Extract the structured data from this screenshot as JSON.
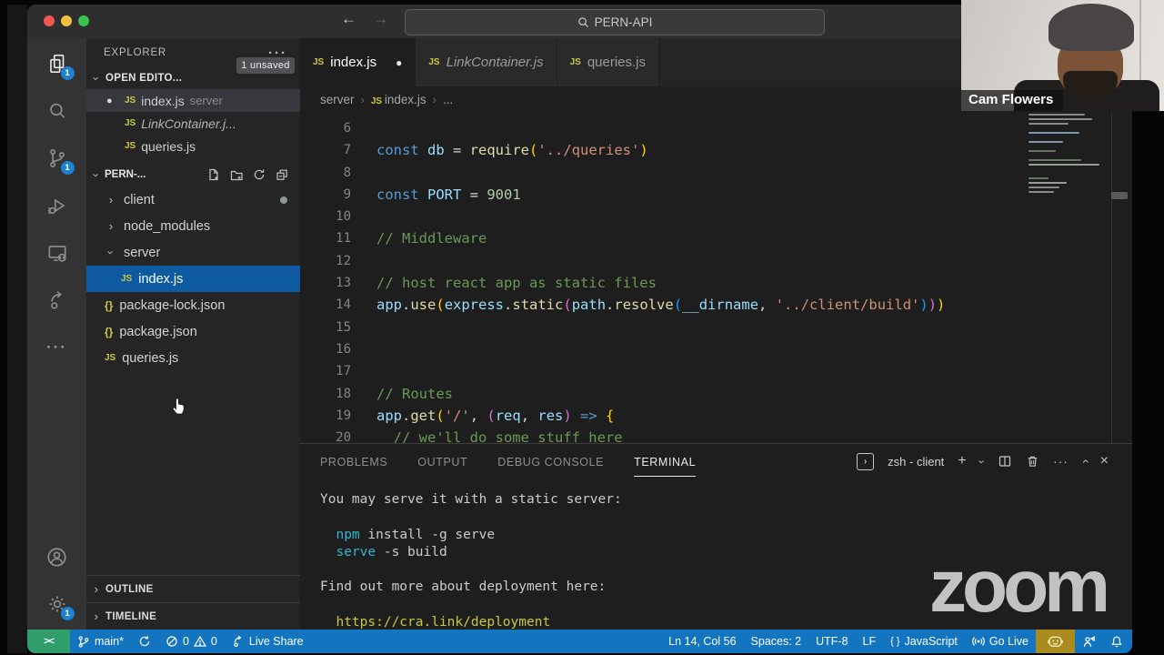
{
  "colors": {
    "status_bar_blue": "#1374c0",
    "remote_segment_green": "#2f9e6a",
    "gold_item": "#a98c1d",
    "selection_blue": "#0e5aa0",
    "activity_badge_blue": "#1d82d4",
    "js_icon_yellow": "#cbcb41"
  },
  "icons": {
    "more": "···",
    "plus": "+",
    "close": "×",
    "chevron": "›",
    "remote": "><",
    "js_badge": "JS",
    "json_badge": "{}",
    "dirty_dot": "●",
    "arrow_back": "←",
    "arrow_forward": "→",
    "brace_pair": "{ }",
    "zsh_glyph": "›"
  },
  "titlebar": {
    "search_title": "PERN-API"
  },
  "activity_bar": {
    "explorer_badge": "1",
    "scm_badge": "1",
    "settings_badge": "1"
  },
  "sidebar": {
    "title": "EXPLORER",
    "open_editors": {
      "label": "OPEN EDITO...",
      "badge": "1 unsaved",
      "items": [
        {
          "label": "index.js",
          "detail": "server",
          "modified": true,
          "selected": true
        },
        {
          "label": "LinkContainer.j...",
          "italic": true
        },
        {
          "label": "queries.js"
        }
      ]
    },
    "tree": {
      "root": "PERN-...",
      "items": [
        {
          "label": "client",
          "chevron": "right",
          "dot": true
        },
        {
          "label": "node_modules",
          "chevron": "right"
        },
        {
          "label": "server",
          "chevron": "down"
        },
        {
          "label": "index.js",
          "icon": "js",
          "indent": 2,
          "selected": true
        },
        {
          "label": "package-lock.json",
          "icon": "json"
        },
        {
          "label": "package.json",
          "icon": "json"
        },
        {
          "label": "queries.js",
          "icon": "js"
        }
      ]
    },
    "outline_label": "OUTLINE",
    "timeline_label": "TIMELINE"
  },
  "tabs": [
    {
      "label": "index.js",
      "active": true,
      "dirty": true
    },
    {
      "label": "LinkContainer.js",
      "italic": true
    },
    {
      "label": "queries.js"
    }
  ],
  "breadcrumb": {
    "items": [
      "server",
      "index.js",
      "..."
    ]
  },
  "editor": {
    "lines": [
      {
        "num": "6",
        "segments": []
      },
      {
        "num": "7",
        "segments": [
          {
            "t": "const ",
            "c": "kw"
          },
          {
            "t": "db ",
            "c": "var"
          },
          {
            "t": "= ",
            "c": "pln"
          },
          {
            "t": "require",
            "c": "fn"
          },
          {
            "t": "(",
            "c": "b1"
          },
          {
            "t": "'../queries'",
            "c": "str"
          },
          {
            "t": ")",
            "c": "b1"
          }
        ]
      },
      {
        "num": "8",
        "segments": []
      },
      {
        "num": "9",
        "segments": [
          {
            "t": "const ",
            "c": "kw"
          },
          {
            "t": "PORT ",
            "c": "var"
          },
          {
            "t": "= ",
            "c": "pln"
          },
          {
            "t": "9001",
            "c": "num"
          }
        ]
      },
      {
        "num": "10",
        "segments": []
      },
      {
        "num": "11",
        "segments": [
          {
            "t": "// Middleware",
            "c": "com"
          }
        ]
      },
      {
        "num": "12",
        "segments": []
      },
      {
        "num": "13",
        "segments": [
          {
            "t": "// host react app as static files",
            "c": "com"
          }
        ]
      },
      {
        "num": "14",
        "segments": [
          {
            "t": "app",
            "c": "var"
          },
          {
            "t": ".",
            "c": "pln"
          },
          {
            "t": "use",
            "c": "fn"
          },
          {
            "t": "(",
            "c": "b1"
          },
          {
            "t": "express",
            "c": "var"
          },
          {
            "t": ".",
            "c": "pln"
          },
          {
            "t": "static",
            "c": "fn"
          },
          {
            "t": "(",
            "c": "b2"
          },
          {
            "t": "path",
            "c": "var"
          },
          {
            "t": ".",
            "c": "pln"
          },
          {
            "t": "resolve",
            "c": "fn"
          },
          {
            "t": "(",
            "c": "b3"
          },
          {
            "t": "__dirname",
            "c": "var"
          },
          {
            "t": ", ",
            "c": "pln"
          },
          {
            "t": "'../client/build'",
            "c": "str"
          },
          {
            "t": ")",
            "c": "b3"
          },
          {
            "t": ")",
            "c": "b2"
          },
          {
            "t": ")",
            "c": "b1"
          }
        ]
      },
      {
        "num": "15",
        "segments": []
      },
      {
        "num": "16",
        "segments": []
      },
      {
        "num": "17",
        "segments": []
      },
      {
        "num": "18",
        "segments": [
          {
            "t": "// Routes",
            "c": "com"
          }
        ]
      },
      {
        "num": "19",
        "segments": [
          {
            "t": "app",
            "c": "var"
          },
          {
            "t": ".",
            "c": "pln"
          },
          {
            "t": "get",
            "c": "fn"
          },
          {
            "t": "(",
            "c": "b1"
          },
          {
            "t": "'/'",
            "c": "str"
          },
          {
            "t": ", ",
            "c": "pln"
          },
          {
            "t": "(",
            "c": "b2"
          },
          {
            "t": "req",
            "c": "var"
          },
          {
            "t": ", ",
            "c": "pln"
          },
          {
            "t": "res",
            "c": "var"
          },
          {
            "t": ")",
            "c": "b2"
          },
          {
            "t": " => ",
            "c": "kw"
          },
          {
            "t": "{",
            "c": "b1"
          }
        ]
      },
      {
        "num": "20",
        "segments": [
          {
            "t": "  // we'll do some stuff here",
            "c": "com"
          }
        ]
      }
    ]
  },
  "panel": {
    "tabs": [
      {
        "label": "PROBLEMS"
      },
      {
        "label": "OUTPUT"
      },
      {
        "label": "DEBUG CONSOLE"
      },
      {
        "label": "TERMINAL",
        "active": true
      }
    ],
    "shell_label": "zsh - client",
    "terminal_lines": [
      {
        "segments": [
          {
            "t": "You may serve it with a static server:"
          }
        ]
      },
      {
        "segments": []
      },
      {
        "segments": [
          {
            "t": "  "
          },
          {
            "t": "npm",
            "c": "cyan"
          },
          {
            "t": " install -g serve"
          }
        ]
      },
      {
        "segments": [
          {
            "t": "  "
          },
          {
            "t": "serve",
            "c": "cyan"
          },
          {
            "t": " -s build"
          }
        ]
      },
      {
        "segments": []
      },
      {
        "segments": [
          {
            "t": "Find out more about deployment here:"
          }
        ]
      },
      {
        "segments": []
      },
      {
        "segments": [
          {
            "t": "  "
          },
          {
            "t": "https://cra.link/deployment",
            "c": "link"
          }
        ]
      }
    ]
  },
  "status_bar": {
    "branch": "main*",
    "errors": "0",
    "warnings": "0",
    "live_share": "Live Share",
    "line_col": "Ln 14, Col 56",
    "spaces": "Spaces: 2",
    "encoding": "UTF-8",
    "eol": "LF",
    "language": "JavaScript",
    "go_live": "Go Live"
  },
  "webcam": {
    "name": "Cam Flowers"
  },
  "watermark": {
    "text": "zoom"
  }
}
